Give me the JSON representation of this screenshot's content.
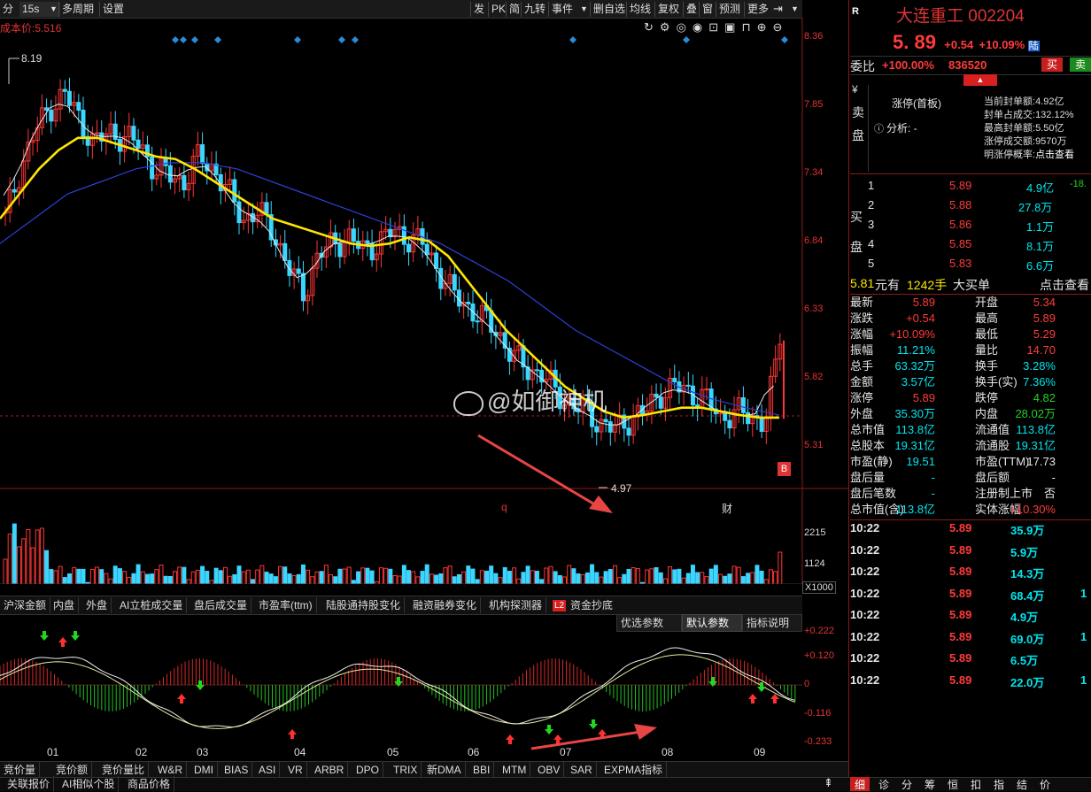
{
  "toolbar": {
    "left": [
      "分",
      "15s",
      "多周期",
      "设置"
    ],
    "right": [
      "发",
      "PK",
      "简",
      "九转",
      "事件",
      "删自选",
      "均线",
      "复权",
      "叠",
      "窗",
      "预测",
      "更多"
    ]
  },
  "chart": {
    "cost_label": "成本价:5.516",
    "price_axis": [
      "8.36",
      "7.85",
      "7.34",
      "6.84",
      "6.33",
      "5.82",
      "5.31"
    ],
    "high_marker": "8.19",
    "low_marker": "4.97",
    "buy_badge": "B",
    "q_marker": "q",
    "cai_marker": "财",
    "watermark": "@如御神机",
    "volume_axis": [
      "2215",
      "1124",
      "X1000"
    ],
    "ma_axis": [
      "+0.222",
      "+0.120",
      "0",
      "-0.116",
      "-0.233"
    ],
    "months": [
      "01",
      "02",
      "03",
      "04",
      "05",
      "06",
      "07",
      "08",
      "09"
    ]
  },
  "chart_data": {
    "type": "candlestick",
    "price_range": [
      4.97,
      8.19
    ],
    "closes": [
      6.9,
      7.3,
      7.6,
      7.8,
      7.9,
      7.7,
      7.5,
      7.6,
      7.55,
      7.5,
      7.3,
      7.25,
      7.2,
      7.4,
      7.3,
      7.1,
      6.9,
      6.95,
      6.8,
      6.5,
      6.3,
      6.6,
      6.7,
      6.75,
      6.65,
      6.7,
      6.8,
      6.75,
      6.7,
      6.5,
      6.3,
      6.2,
      6.1,
      6.0,
      5.8,
      5.7,
      5.65,
      5.5,
      5.4,
      5.35,
      5.25,
      5.2,
      5.3,
      5.35,
      5.5,
      5.55,
      5.5,
      5.45,
      5.3,
      5.35,
      5.3,
      5.28,
      5.89
    ],
    "ma_yellow": [
      6.9,
      7.1,
      7.3,
      7.45,
      7.55,
      7.55,
      7.5,
      7.45,
      7.4,
      7.38,
      7.3,
      7.2,
      7.1,
      7.0,
      6.9,
      6.85,
      6.8,
      6.75,
      6.7,
      6.68,
      6.7,
      6.75,
      6.72,
      6.6,
      6.4,
      6.2,
      6.0,
      5.85,
      5.7,
      5.55,
      5.45,
      5.35,
      5.3,
      5.32,
      5.35,
      5.38,
      5.38,
      5.35,
      5.32,
      5.3,
      5.3
    ],
    "ma_blue": [
      6.7,
      6.9,
      7.1,
      7.2,
      7.3,
      7.35,
      7.35,
      7.3,
      7.2,
      7.1,
      7.0,
      6.9,
      6.8,
      6.7,
      6.55,
      6.4,
      6.2,
      6.0,
      5.85,
      5.7,
      5.55,
      5.45,
      5.38,
      5.32
    ]
  },
  "indicator_tabs": [
    "沪深金额",
    "内盘",
    "外盘",
    "AI立桩成交量",
    "盘后成交量",
    "市盈率(ttm)",
    "陆股通持股变化",
    "融资融券变化",
    "机构探测器",
    "资金抄底"
  ],
  "l2_badge": "L2",
  "param_buttons": [
    "优选参数",
    "默认参数",
    "指标说明"
  ],
  "bottom_tabs": [
    "竞价量",
    "竞价额",
    "竞价量比",
    "W&R",
    "DMI",
    "BIAS",
    "ASI",
    "VR",
    "ARBR",
    "DPO",
    "TRIX",
    "新DMA",
    "BBI",
    "MTM",
    "OBV",
    "SAR",
    "EXPMA指标"
  ],
  "footer_tabs": [
    "关联报价",
    "AI相似个股",
    "商品价格"
  ],
  "quote": {
    "name": "大连重工",
    "code": "002204",
    "r_label": "R",
    "price": "5. 89",
    "change": "+0.54",
    "pct": "+10.09%",
    "lu_badge": "陆",
    "weibi_label": "委比",
    "weibi": "+100.00%",
    "weicha": "836520",
    "buy_btn": "买",
    "sell_btn": "卖",
    "sell_side_label": [
      "¥",
      "卖",
      "盘"
    ],
    "limit_title": "涨停(首板)",
    "analysis": "分析: -",
    "limit_info": [
      {
        "k": "当前封单额:",
        "v": "4.92亿"
      },
      {
        "k": "封单占成交:",
        "v": "132.12%"
      },
      {
        "k": "最高封单额:",
        "v": "5.50亿"
      },
      {
        "k": "涨停成交额:",
        "v": "9570万"
      },
      {
        "k": "明涨停概率:",
        "v": "点击查看"
      }
    ],
    "buy_side_label": [
      "买",
      "盘"
    ],
    "bids": [
      {
        "lvl": "1",
        "price": "5.89",
        "vol": "4.9亿",
        "extra": "-18."
      },
      {
        "lvl": "2",
        "price": "5.88",
        "vol": "27.8万",
        "extra": ""
      },
      {
        "lvl": "3",
        "price": "5.86",
        "vol": "1.1万",
        "extra": ""
      },
      {
        "lvl": "4",
        "price": "5.85",
        "vol": "8.1万",
        "extra": ""
      },
      {
        "lvl": "5",
        "price": "5.83",
        "vol": "6.6万",
        "extra": ""
      }
    ],
    "big_buy": {
      "price": "5.81",
      "unit1": "元有",
      "qty": "1242手",
      "label": "大买单",
      "link": "点击查看"
    },
    "stats_left": [
      {
        "k": "最新",
        "v": "5.89"
      },
      {
        "k": "涨跌",
        "v": "+0.54"
      },
      {
        "k": "涨幅",
        "v": "+10.09%"
      },
      {
        "k": "振幅",
        "v": "11.21%"
      },
      {
        "k": "总手",
        "v": "63.32万"
      },
      {
        "k": "金额",
        "v": "3.57亿"
      },
      {
        "k": "涨停",
        "v": "5.89"
      },
      {
        "k": "外盘",
        "v": "35.30万"
      },
      {
        "k": "总市值",
        "v": "113.8亿"
      },
      {
        "k": "总股本",
        "v": "19.31亿"
      },
      {
        "k": "市盈(静)",
        "v": "19.51"
      },
      {
        "k": "盘后量",
        "v": "-"
      },
      {
        "k": "盘后笔数",
        "v": "-"
      },
      {
        "k": "总市值(含)",
        "v": "113.8亿"
      }
    ],
    "stats_right": [
      {
        "k": "开盘",
        "v": "5.34"
      },
      {
        "k": "最高",
        "v": "5.89"
      },
      {
        "k": "最低",
        "v": "5.29"
      },
      {
        "k": "量比",
        "v": "14.70"
      },
      {
        "k": "换手",
        "v": "3.28%"
      },
      {
        "k": "换手(实)",
        "v": "7.36%"
      },
      {
        "k": "跌停",
        "v": "4.82"
      },
      {
        "k": "内盘",
        "v": "28.02万"
      },
      {
        "k": "流通值",
        "v": "113.8亿"
      },
      {
        "k": "流通股",
        "v": "19.31亿"
      },
      {
        "k": "市盈(TTM)",
        "v": "17.73"
      },
      {
        "k": "盘后额",
        "v": "-"
      },
      {
        "k": "注册制上市",
        "v": "否"
      },
      {
        "k": "实体涨幅",
        "v": "+10.30%"
      }
    ],
    "trades": [
      {
        "t": "10:22",
        "p": "5.89",
        "v": "35.9万",
        "n": ""
      },
      {
        "t": "10:22",
        "p": "5.89",
        "v": "5.9万",
        "n": ""
      },
      {
        "t": "10:22",
        "p": "5.89",
        "v": "14.3万",
        "n": ""
      },
      {
        "t": "10:22",
        "p": "5.89",
        "v": "68.4万",
        "n": "1"
      },
      {
        "t": "10:22",
        "p": "5.89",
        "v": "4.9万",
        "n": ""
      },
      {
        "t": "10:22",
        "p": "5.89",
        "v": "69.0万",
        "n": "1"
      },
      {
        "t": "10:22",
        "p": "5.89",
        "v": "6.5万",
        "n": ""
      },
      {
        "t": "10:22",
        "p": "5.89",
        "v": "22.0万",
        "n": "1"
      }
    ],
    "bottom_tabs": [
      "细",
      "诊",
      "分",
      "筹",
      "恒",
      "扣",
      "指",
      "结",
      "价"
    ]
  }
}
